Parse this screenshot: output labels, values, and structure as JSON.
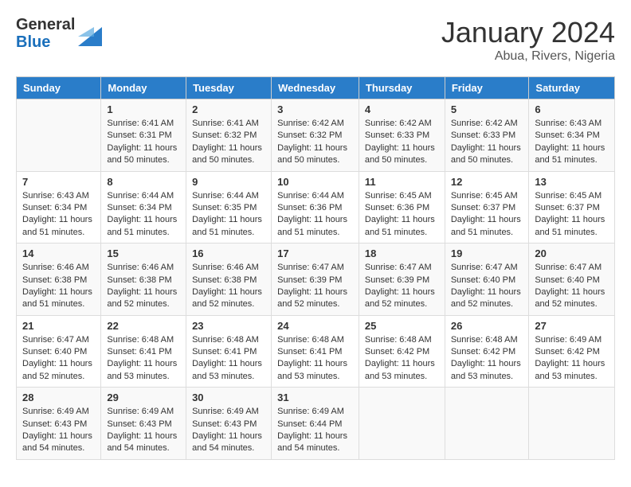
{
  "header": {
    "logo_general": "General",
    "logo_blue": "Blue",
    "month_year": "January 2024",
    "location": "Abua, Rivers, Nigeria"
  },
  "weekdays": [
    "Sunday",
    "Monday",
    "Tuesday",
    "Wednesday",
    "Thursday",
    "Friday",
    "Saturday"
  ],
  "weeks": [
    [
      {
        "day": "",
        "sunrise": "",
        "sunset": "",
        "daylight": ""
      },
      {
        "day": "1",
        "sunrise": "Sunrise: 6:41 AM",
        "sunset": "Sunset: 6:31 PM",
        "daylight": "Daylight: 11 hours and 50 minutes."
      },
      {
        "day": "2",
        "sunrise": "Sunrise: 6:41 AM",
        "sunset": "Sunset: 6:32 PM",
        "daylight": "Daylight: 11 hours and 50 minutes."
      },
      {
        "day": "3",
        "sunrise": "Sunrise: 6:42 AM",
        "sunset": "Sunset: 6:32 PM",
        "daylight": "Daylight: 11 hours and 50 minutes."
      },
      {
        "day": "4",
        "sunrise": "Sunrise: 6:42 AM",
        "sunset": "Sunset: 6:33 PM",
        "daylight": "Daylight: 11 hours and 50 minutes."
      },
      {
        "day": "5",
        "sunrise": "Sunrise: 6:42 AM",
        "sunset": "Sunset: 6:33 PM",
        "daylight": "Daylight: 11 hours and 50 minutes."
      },
      {
        "day": "6",
        "sunrise": "Sunrise: 6:43 AM",
        "sunset": "Sunset: 6:34 PM",
        "daylight": "Daylight: 11 hours and 51 minutes."
      }
    ],
    [
      {
        "day": "7",
        "sunrise": "Sunrise: 6:43 AM",
        "sunset": "Sunset: 6:34 PM",
        "daylight": "Daylight: 11 hours and 51 minutes."
      },
      {
        "day": "8",
        "sunrise": "Sunrise: 6:44 AM",
        "sunset": "Sunset: 6:34 PM",
        "daylight": "Daylight: 11 hours and 51 minutes."
      },
      {
        "day": "9",
        "sunrise": "Sunrise: 6:44 AM",
        "sunset": "Sunset: 6:35 PM",
        "daylight": "Daylight: 11 hours and 51 minutes."
      },
      {
        "day": "10",
        "sunrise": "Sunrise: 6:44 AM",
        "sunset": "Sunset: 6:36 PM",
        "daylight": "Daylight: 11 hours and 51 minutes."
      },
      {
        "day": "11",
        "sunrise": "Sunrise: 6:45 AM",
        "sunset": "Sunset: 6:36 PM",
        "daylight": "Daylight: 11 hours and 51 minutes."
      },
      {
        "day": "12",
        "sunrise": "Sunrise: 6:45 AM",
        "sunset": "Sunset: 6:37 PM",
        "daylight": "Daylight: 11 hours and 51 minutes."
      },
      {
        "day": "13",
        "sunrise": "Sunrise: 6:45 AM",
        "sunset": "Sunset: 6:37 PM",
        "daylight": "Daylight: 11 hours and 51 minutes."
      }
    ],
    [
      {
        "day": "14",
        "sunrise": "Sunrise: 6:46 AM",
        "sunset": "Sunset: 6:38 PM",
        "daylight": "Daylight: 11 hours and 51 minutes."
      },
      {
        "day": "15",
        "sunrise": "Sunrise: 6:46 AM",
        "sunset": "Sunset: 6:38 PM",
        "daylight": "Daylight: 11 hours and 52 minutes."
      },
      {
        "day": "16",
        "sunrise": "Sunrise: 6:46 AM",
        "sunset": "Sunset: 6:38 PM",
        "daylight": "Daylight: 11 hours and 52 minutes."
      },
      {
        "day": "17",
        "sunrise": "Sunrise: 6:47 AM",
        "sunset": "Sunset: 6:39 PM",
        "daylight": "Daylight: 11 hours and 52 minutes."
      },
      {
        "day": "18",
        "sunrise": "Sunrise: 6:47 AM",
        "sunset": "Sunset: 6:39 PM",
        "daylight": "Daylight: 11 hours and 52 minutes."
      },
      {
        "day": "19",
        "sunrise": "Sunrise: 6:47 AM",
        "sunset": "Sunset: 6:40 PM",
        "daylight": "Daylight: 11 hours and 52 minutes."
      },
      {
        "day": "20",
        "sunrise": "Sunrise: 6:47 AM",
        "sunset": "Sunset: 6:40 PM",
        "daylight": "Daylight: 11 hours and 52 minutes."
      }
    ],
    [
      {
        "day": "21",
        "sunrise": "Sunrise: 6:47 AM",
        "sunset": "Sunset: 6:40 PM",
        "daylight": "Daylight: 11 hours and 52 minutes."
      },
      {
        "day": "22",
        "sunrise": "Sunrise: 6:48 AM",
        "sunset": "Sunset: 6:41 PM",
        "daylight": "Daylight: 11 hours and 53 minutes."
      },
      {
        "day": "23",
        "sunrise": "Sunrise: 6:48 AM",
        "sunset": "Sunset: 6:41 PM",
        "daylight": "Daylight: 11 hours and 53 minutes."
      },
      {
        "day": "24",
        "sunrise": "Sunrise: 6:48 AM",
        "sunset": "Sunset: 6:41 PM",
        "daylight": "Daylight: 11 hours and 53 minutes."
      },
      {
        "day": "25",
        "sunrise": "Sunrise: 6:48 AM",
        "sunset": "Sunset: 6:42 PM",
        "daylight": "Daylight: 11 hours and 53 minutes."
      },
      {
        "day": "26",
        "sunrise": "Sunrise: 6:48 AM",
        "sunset": "Sunset: 6:42 PM",
        "daylight": "Daylight: 11 hours and 53 minutes."
      },
      {
        "day": "27",
        "sunrise": "Sunrise: 6:49 AM",
        "sunset": "Sunset: 6:42 PM",
        "daylight": "Daylight: 11 hours and 53 minutes."
      }
    ],
    [
      {
        "day": "28",
        "sunrise": "Sunrise: 6:49 AM",
        "sunset": "Sunset: 6:43 PM",
        "daylight": "Daylight: 11 hours and 54 minutes."
      },
      {
        "day": "29",
        "sunrise": "Sunrise: 6:49 AM",
        "sunset": "Sunset: 6:43 PM",
        "daylight": "Daylight: 11 hours and 54 minutes."
      },
      {
        "day": "30",
        "sunrise": "Sunrise: 6:49 AM",
        "sunset": "Sunset: 6:43 PM",
        "daylight": "Daylight: 11 hours and 54 minutes."
      },
      {
        "day": "31",
        "sunrise": "Sunrise: 6:49 AM",
        "sunset": "Sunset: 6:44 PM",
        "daylight": "Daylight: 11 hours and 54 minutes."
      },
      {
        "day": "",
        "sunrise": "",
        "sunset": "",
        "daylight": ""
      },
      {
        "day": "",
        "sunrise": "",
        "sunset": "",
        "daylight": ""
      },
      {
        "day": "",
        "sunrise": "",
        "sunset": "",
        "daylight": ""
      }
    ]
  ]
}
